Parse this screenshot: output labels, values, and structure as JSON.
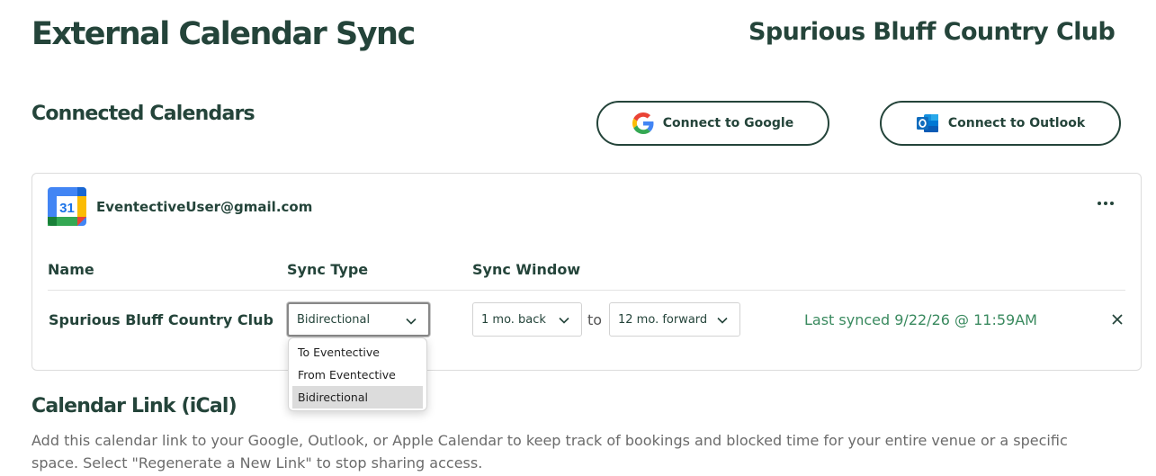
{
  "header": {
    "title": "External Calendar Sync",
    "venue": "Spurious Bluff Country Club"
  },
  "connected": {
    "title": "Connected Calendars",
    "google_button": "Connect to Google",
    "outlook_button": "Connect to Outlook"
  },
  "account": {
    "calendar_day": "31",
    "email": "EventectiveUser@gmail.com",
    "columns": {
      "name": "Name",
      "sync_type": "Sync Type",
      "sync_window": "Sync Window"
    },
    "row": {
      "name": "Spurious Bluff Country Club",
      "sync_type": "Bidirectional",
      "window_back": "1 mo. back",
      "to": "to",
      "window_forward": "12 mo. forward",
      "last_synced": "Last synced 9/22/26 @ 11:59AM"
    },
    "sync_type_options": [
      "To Eventective",
      "From Eventective",
      "Bidirectional"
    ]
  },
  "ical": {
    "title": "Calendar Link (iCal)",
    "description": "Add this calendar link to your Google, Outlook, or Apple Calendar to keep track of bookings and blocked time for your entire venue or a specific space. Select \"Regenerate a New Link\" to stop sharing access."
  },
  "colors": {
    "brand_dark": "#24443a",
    "synced_green": "#3a8a5f"
  },
  "icons": [
    "google-icon",
    "outlook-icon",
    "google-calendar-icon",
    "more-icon",
    "chevron-down-icon",
    "close-icon"
  ]
}
